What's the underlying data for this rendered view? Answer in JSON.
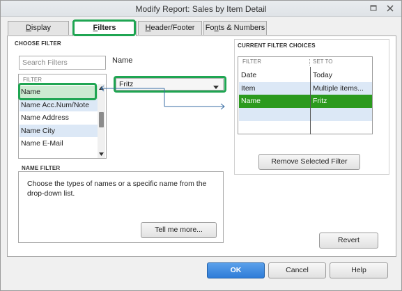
{
  "window": {
    "title": "Modify Report: Sales by Item Detail",
    "colors": {
      "highlight": "#1fa552",
      "selected_row": "#2b9a1e",
      "alt_row": "#dce8f6",
      "primary_button": "#2f7cd8"
    }
  },
  "tabs": [
    {
      "label": "Display",
      "mnemonic": "D",
      "rest": "isplay",
      "active": false
    },
    {
      "label": "Filters",
      "mnemonic": "F",
      "rest": "ilters",
      "active": true
    },
    {
      "label": "Header/Footer",
      "mnemonic": "H",
      "rest": "eader/Footer",
      "active": false
    },
    {
      "label": "Fonts & Numbers",
      "pre": "Fo",
      "mnemonic": "n",
      "rest": "ts & Numbers",
      "active": false
    }
  ],
  "choose_filter": {
    "heading": "CHOOSE FILTER",
    "search_placeholder": "Search Filters",
    "list_header": "FILTER",
    "items": [
      "Name",
      "Name Acc.Num/Note",
      "Name Address",
      "Name City",
      "Name E-Mail"
    ],
    "selected_index": 0
  },
  "filter_value": {
    "label": "Name",
    "selected": "Fritz"
  },
  "name_filter": {
    "heading": "NAME FILTER",
    "help": "Choose the types of names or a specific name from the drop-down list.",
    "tell_me_more": "Tell me more..."
  },
  "current_filters": {
    "heading": "CURRENT FILTER CHOICES",
    "col_filter": "FILTER",
    "col_set_to": "SET TO",
    "rows": [
      {
        "filter": "Date",
        "set_to": "Today"
      },
      {
        "filter": "Item",
        "set_to": "Multiple items..."
      },
      {
        "filter": "Name",
        "set_to": "Fritz"
      }
    ],
    "selected_index": 2,
    "remove_button": "Remove Selected Filter"
  },
  "buttons": {
    "revert": "Revert",
    "ok": "OK",
    "cancel": "Cancel",
    "help": "Help"
  }
}
